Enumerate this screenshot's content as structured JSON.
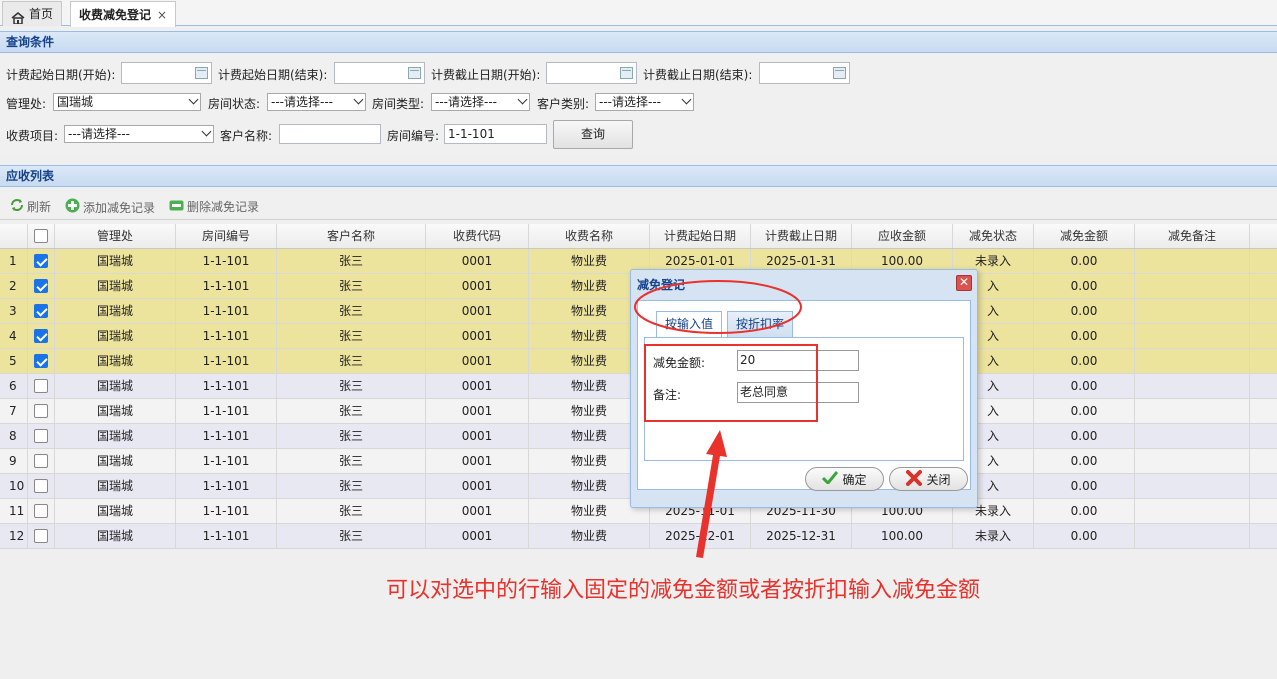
{
  "tabs": [
    {
      "label": "首页"
    },
    {
      "label": "收费减免登记"
    }
  ],
  "query": {
    "header": "查询条件",
    "fields": {
      "charge_start_from": "计费起始日期(开始):",
      "charge_start_to": "计费起始日期(结束):",
      "charge_end_from": "计费截止日期(开始):",
      "charge_end_to": "计费截止日期(结束):",
      "office": "管理处:",
      "office_value": "国瑞城",
      "room_status": "房间状态:",
      "room_type": "房间类型:",
      "customer_type": "客户类别:",
      "placeholder": "---请选择---",
      "charge_item": "收费项目:",
      "customer_name": "客户名称:",
      "room_no": "房间编号:",
      "room_no_value": "1-1-101",
      "search": "查询"
    }
  },
  "list": {
    "header": "应收列表",
    "toolbar": {
      "refresh": "刷新",
      "add": "添加减免记录",
      "delete": "删除减免记录"
    },
    "columns": [
      "管理处",
      "房间编号",
      "客户名称",
      "收费代码",
      "收费名称",
      "计费起始日期",
      "计费截止日期",
      "应收金额",
      "减免状态",
      "减免金额",
      "减免备注"
    ],
    "rows": [
      {
        "n": "1",
        "checked": true,
        "office": "国瑞城",
        "room": "1-1-101",
        "customer": "张三",
        "code": "0001",
        "name": "物业费",
        "start": "2025-01-01",
        "end": "2025-01-31",
        "amount": "100.00",
        "status": "未录入",
        "waive": "0.00"
      },
      {
        "n": "2",
        "checked": true,
        "office": "国瑞城",
        "room": "1-1-101",
        "customer": "张三",
        "code": "0001",
        "name": "物业费",
        "start": "",
        "end": "",
        "amount": "",
        "status": "入",
        "waive": "0.00"
      },
      {
        "n": "3",
        "checked": true,
        "office": "国瑞城",
        "room": "1-1-101",
        "customer": "张三",
        "code": "0001",
        "name": "物业费",
        "start": "",
        "end": "",
        "amount": "",
        "status": "入",
        "waive": "0.00"
      },
      {
        "n": "4",
        "checked": true,
        "office": "国瑞城",
        "room": "1-1-101",
        "customer": "张三",
        "code": "0001",
        "name": "物业费",
        "start": "",
        "end": "",
        "amount": "",
        "status": "入",
        "waive": "0.00"
      },
      {
        "n": "5",
        "checked": true,
        "office": "国瑞城",
        "room": "1-1-101",
        "customer": "张三",
        "code": "0001",
        "name": "物业费",
        "start": "",
        "end": "",
        "amount": "",
        "status": "入",
        "waive": "0.00"
      },
      {
        "n": "6",
        "checked": false,
        "office": "国瑞城",
        "room": "1-1-101",
        "customer": "张三",
        "code": "0001",
        "name": "物业费",
        "start": "",
        "end": "",
        "amount": "",
        "status": "入",
        "waive": "0.00"
      },
      {
        "n": "7",
        "checked": false,
        "office": "国瑞城",
        "room": "1-1-101",
        "customer": "张三",
        "code": "0001",
        "name": "物业费",
        "start": "",
        "end": "",
        "amount": "",
        "status": "入",
        "waive": "0.00"
      },
      {
        "n": "8",
        "checked": false,
        "office": "国瑞城",
        "room": "1-1-101",
        "customer": "张三",
        "code": "0001",
        "name": "物业费",
        "start": "",
        "end": "",
        "amount": "",
        "status": "入",
        "waive": "0.00"
      },
      {
        "n": "9",
        "checked": false,
        "office": "国瑞城",
        "room": "1-1-101",
        "customer": "张三",
        "code": "0001",
        "name": "物业费",
        "start": "",
        "end": "",
        "amount": "",
        "status": "入",
        "waive": "0.00"
      },
      {
        "n": "10",
        "checked": false,
        "office": "国瑞城",
        "room": "1-1-101",
        "customer": "张三",
        "code": "0001",
        "name": "物业费",
        "start": "",
        "end": "",
        "amount": "",
        "status": "入",
        "waive": "0.00"
      },
      {
        "n": "11",
        "checked": false,
        "office": "国瑞城",
        "room": "1-1-101",
        "customer": "张三",
        "code": "0001",
        "name": "物业费",
        "start": "2025-11-01",
        "end": "2025-11-30",
        "amount": "100.00",
        "status": "未录入",
        "waive": "0.00"
      },
      {
        "n": "12",
        "checked": false,
        "office": "国瑞城",
        "room": "1-1-101",
        "customer": "张三",
        "code": "0001",
        "name": "物业费",
        "start": "2025-12-01",
        "end": "2025-12-31",
        "amount": "100.00",
        "status": "未录入",
        "waive": "0.00"
      }
    ]
  },
  "dialog": {
    "title": "减免登记",
    "close": "✕",
    "tab_value": "按输入值",
    "tab_rate": "按折扣率",
    "amount_label": "减免金额:",
    "amount_value": "20",
    "remark_label": "备注:",
    "remark_value": "老总同意",
    "ok": "确定",
    "cancel": "关闭"
  },
  "annotation": "可以对选中的行输入固定的减免金额或者按折扣输入减免金额",
  "colors": {
    "annotation": "#e8322b",
    "selected_row": "#ece39c",
    "header_text": "#15428b"
  }
}
